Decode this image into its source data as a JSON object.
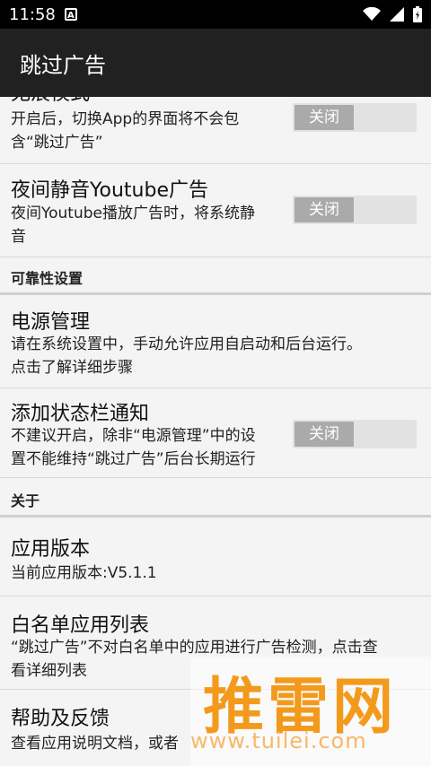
{
  "status_bar": {
    "time": "11:58",
    "notification_icon": "a-icon",
    "icons": [
      "wifi-icon",
      "signal-icon",
      "battery-icon"
    ]
  },
  "toolbar": {
    "title": "跳过广告"
  },
  "items": {
    "top_partial_title": "无痕模式",
    "traceless": {
      "desc_line1": "开启后，切换App的界面将不会包",
      "desc_line2": "含“跳过广告”",
      "toggle_label": "关闭"
    },
    "night_mute": {
      "title": "夜间静音Youtube广告",
      "desc_line1": "夜间Youtube播放广告时，将系统静",
      "desc_line2": "音",
      "toggle_label": "关闭"
    },
    "reliability_header": "可靠性设置",
    "power": {
      "title": "电源管理",
      "desc_line1": "请在系统设置中，手动允许应用自启动和后台运行。",
      "desc_line2": "点击了解详细步骤"
    },
    "statusbar_notify": {
      "title": "添加状态栏通知",
      "desc_line1": "不建议开启，除非“电源管理”中的设",
      "desc_line2": "置不能维持“跳过广告”后台长期运行",
      "toggle_label": "关闭"
    },
    "about_header": "关于",
    "version": {
      "title": "应用版本",
      "desc": "当前应用版本:V5.1.1"
    },
    "whitelist": {
      "title": "白名单应用列表",
      "desc_line1": "“跳过广告”不对白名单中的应用进行广告检测，点击查",
      "desc_line2": "看详细列表"
    },
    "help": {
      "title": "帮助及反馈",
      "desc": "查看应用说明文档，或者"
    }
  },
  "watermark": {
    "text": "推雷网",
    "url": "www.tuilei.com"
  },
  "colors": {
    "toolbar_bg": "#212121",
    "status_bar_bg": "#000000",
    "list_bg": "#f4f4f4",
    "toggle_track": "#e2e2e2",
    "toggle_knob": "#aaaaaa",
    "watermark_orange": "#f39a1c"
  }
}
